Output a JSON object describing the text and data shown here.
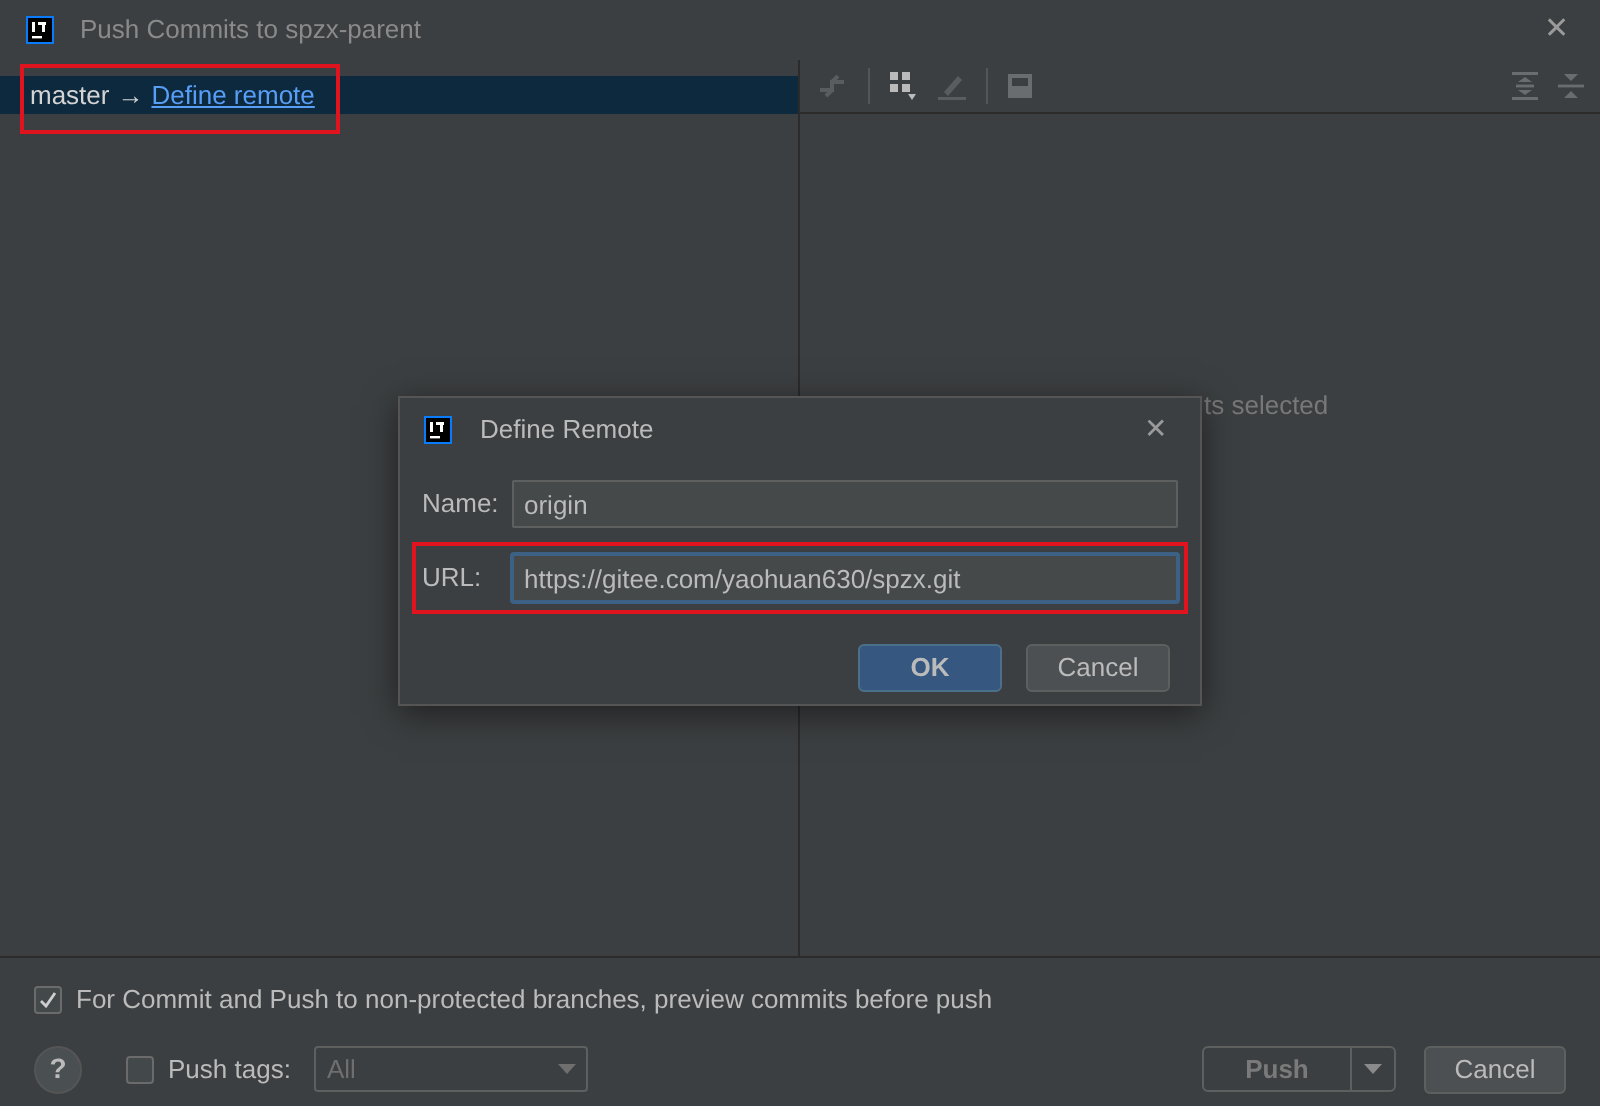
{
  "window": {
    "title": "Push Commits to spzx-parent",
    "close": "✕"
  },
  "branch_row": {
    "branch": "master",
    "arrow": "→",
    "link": "Define remote",
    "selected": true,
    "highlighted": true
  },
  "details_panel": {
    "empty_text": "ts selected"
  },
  "dialog": {
    "title": "Define Remote",
    "close": "✕",
    "fields": [
      {
        "label": "Name:",
        "value": "origin",
        "focused": false,
        "highlighted": false
      },
      {
        "label": "URL:",
        "value": "https://gitee.com/yaohuan630/spzx.git",
        "focused": true,
        "highlighted": true
      }
    ],
    "buttons": [
      {
        "label": "OK",
        "kind": "primary"
      },
      {
        "label": "Cancel",
        "kind": "secondary"
      }
    ]
  },
  "preview_option": {
    "label": "For Commit and Push to non-protected branches, preview commits before push",
    "checked": true
  },
  "footer": {
    "help": "?",
    "push_tags": {
      "label": "Push tags:",
      "checked": false
    },
    "tags_select": {
      "value": "All",
      "disabled": true
    },
    "buttons": [
      {
        "label": "Push",
        "kind": "split",
        "disabled": true
      },
      {
        "label": "Cancel",
        "kind": "secondary",
        "disabled": false
      }
    ]
  }
}
